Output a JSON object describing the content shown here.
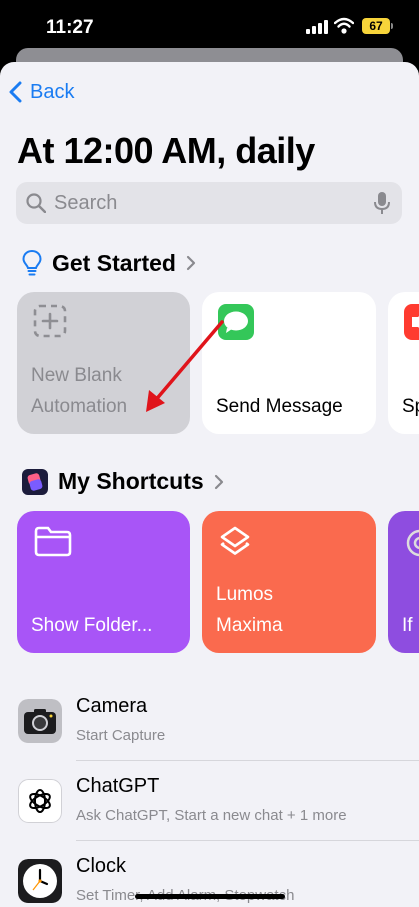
{
  "status_bar": {
    "time": "11:27",
    "battery": "67"
  },
  "nav": {
    "back_label": "Back"
  },
  "page": {
    "title": "At 12:00 AM, daily"
  },
  "search": {
    "placeholder": "Search"
  },
  "sections": {
    "get_started": "Get Started",
    "my_shortcuts": "My Shortcuts"
  },
  "get_started_cards": {
    "new_blank": [
      "New Blank",
      "Automation"
    ],
    "send_message": "Send Message",
    "partial": "Sp"
  },
  "shortcut_cards": {
    "show_folder": "Show Folder...",
    "lumos": [
      "Lumos",
      "Maxima"
    ],
    "partial": "If"
  },
  "apps": [
    {
      "name": "Camera",
      "subtitle": "Start Capture"
    },
    {
      "name": "ChatGPT",
      "subtitle": "Ask ChatGPT, Start a new chat + 1 more"
    },
    {
      "name": "Clock",
      "subtitle": "Set Timer, Add Alarm, Stopwatch"
    }
  ],
  "colors": {
    "accent": "#1a7cf2",
    "purple_card": "#a855f7",
    "orange_card": "#fa6a4e",
    "annotation_arrow": "#e0141b"
  }
}
